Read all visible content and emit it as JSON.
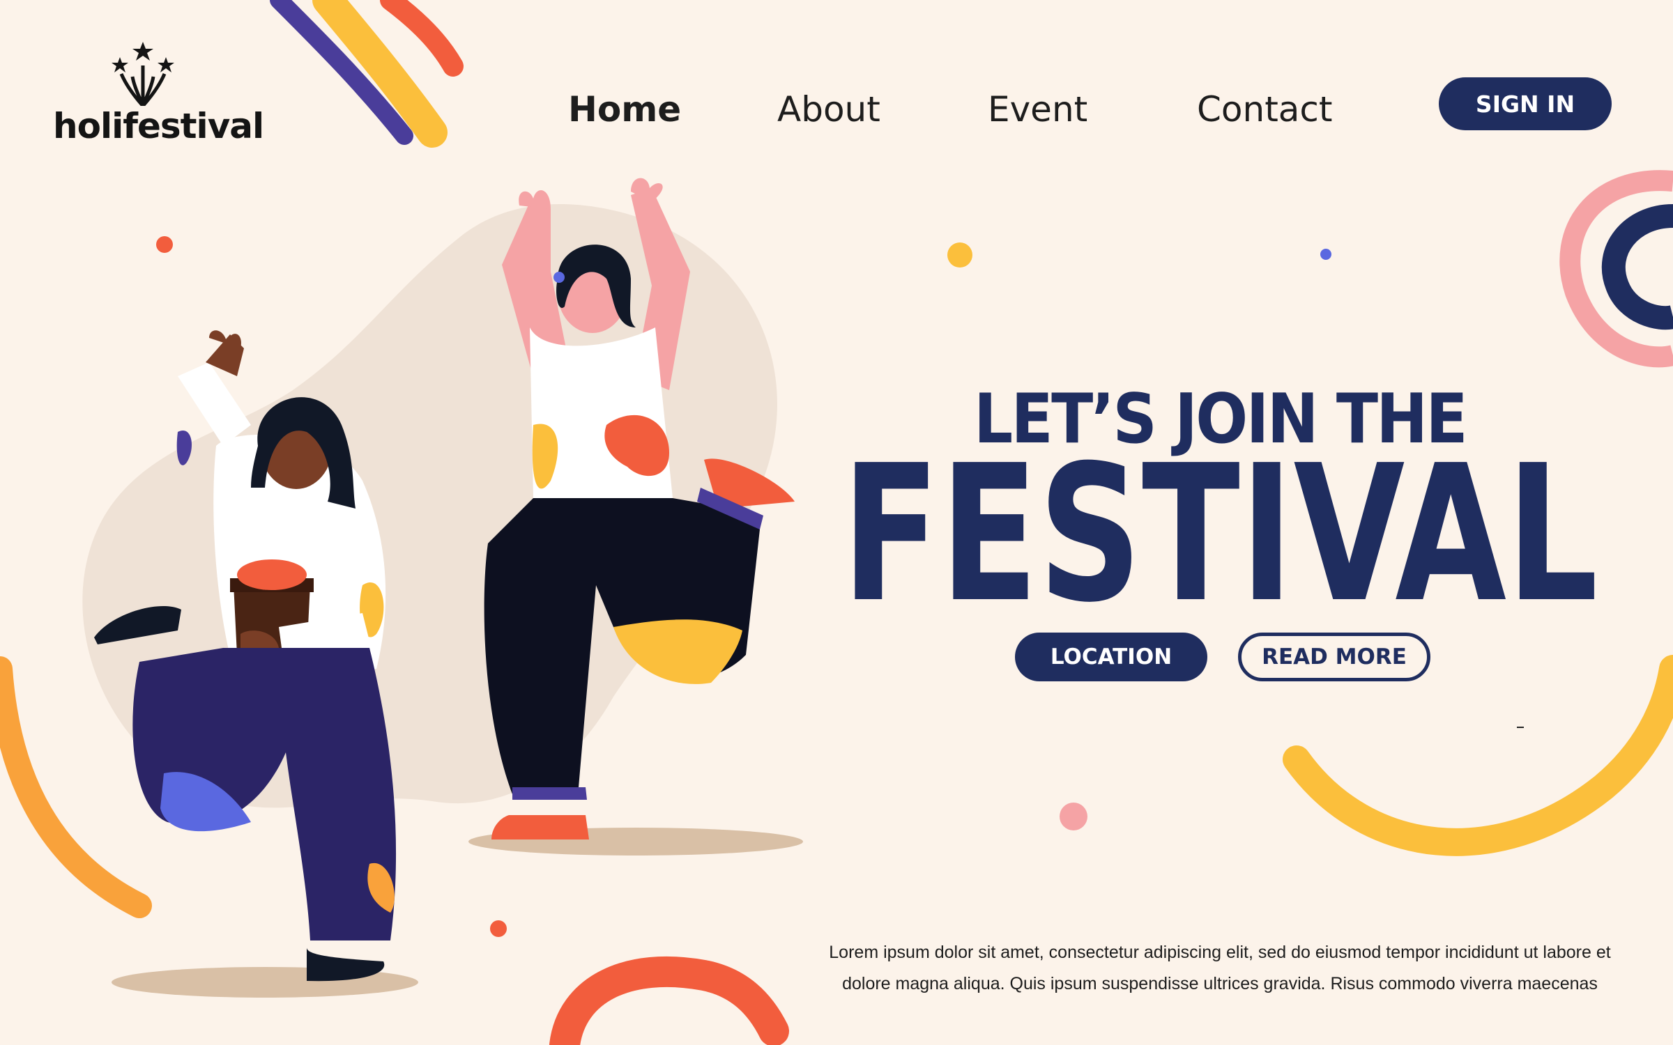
{
  "logo": {
    "text": "holifestival"
  },
  "nav": {
    "items": [
      {
        "label": "Home",
        "active": true
      },
      {
        "label": "About",
        "active": false
      },
      {
        "label": "Event",
        "active": false
      },
      {
        "label": "Contact",
        "active": false
      }
    ],
    "sign_in_label": "SIGN IN"
  },
  "hero": {
    "heading_small": "LET’S JOIN THE",
    "heading_large": "FESTIVAL",
    "location_label": "LOCATION",
    "read_more_label": "READ MORE",
    "body_line1": "Lorem ipsum dolor sit amet, consectetur adipiscing elit, sed do eiusmod tempor incididunt ut labore et",
    "body_line2": "dolore magna aliqua. Quis ipsum suspendisse ultrices gravida. Risus commodo viverra maecenas"
  },
  "colors": {
    "background": "#fcf3ea",
    "navy": "#1f2d5f",
    "coral": "#f25d3d",
    "yellow": "#fbbf3c",
    "pink": "#f5a3a5",
    "purple": "#4a3d9a"
  },
  "icons": {
    "logo": "fireworks-icon"
  }
}
